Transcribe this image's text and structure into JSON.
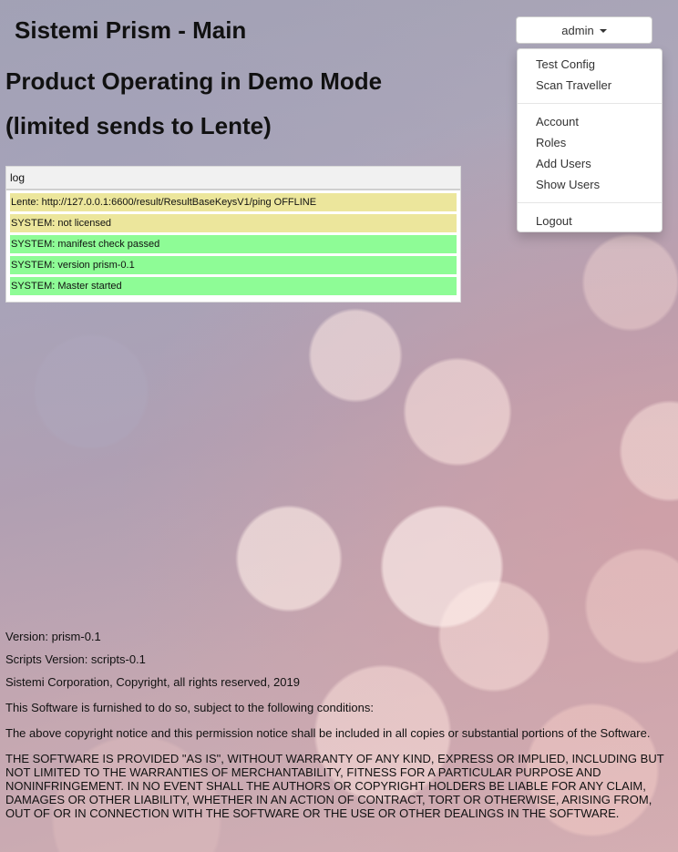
{
  "header": {
    "title": "Sistemi Prism - Main",
    "user_menu_label": "admin"
  },
  "user_menu": {
    "items": [
      {
        "label": "Test Config"
      },
      {
        "label": "Scan Traveller"
      },
      {
        "label": "Account"
      },
      {
        "label": "Roles"
      },
      {
        "label": "Add Users"
      },
      {
        "label": "Show Users"
      },
      {
        "label": "Logout"
      }
    ]
  },
  "demo_notice": {
    "line1": "Product Operating in Demo Mode",
    "line2": "(limited sends to Lente)"
  },
  "log": {
    "header": "log",
    "entries": [
      {
        "text": "Lente: http://127.0.0.1:6600/result/ResultBaseKeysV1/ping OFFLINE",
        "status": "warning",
        "color": "#ece69c"
      },
      {
        "text": "SYSTEM: not licensed",
        "status": "warning",
        "color": "#ece69c"
      },
      {
        "text": "SYSTEM: manifest check passed",
        "status": "ok",
        "color": "#8efc96"
      },
      {
        "text": "SYSTEM: version prism-0.1",
        "status": "ok",
        "color": "#8efc96"
      },
      {
        "text": "SYSTEM: Master started",
        "status": "ok",
        "color": "#8efc96"
      }
    ]
  },
  "footer": {
    "version": "Version: prism-0.1",
    "scripts_version": "Scripts Version: scripts-0.1",
    "copyright": "Sistemi Corporation, Copyright, all rights reserved, 2019",
    "conditions": "This Software is furnished to do so, subject to the following conditions:",
    "notice": "The above copyright notice and this permission notice shall be included in all copies or substantial portions of the Software.",
    "warranty": "THE SOFTWARE IS PROVIDED \"AS IS\", WITHOUT WARRANTY OF ANY KIND, EXPRESS OR IMPLIED, INCLUDING BUT NOT LIMITED TO THE WARRANTIES OF MERCHANTABILITY, FITNESS FOR A PARTICULAR PURPOSE AND NONINFRINGEMENT. IN NO EVENT SHALL THE AUTHORS OR COPYRIGHT HOLDERS BE LIABLE FOR ANY CLAIM, DAMAGES OR OTHER LIABILITY, WHETHER IN AN ACTION OF CONTRACT, TORT OR OTHERWISE, ARISING FROM, OUT OF OR IN CONNECTION WITH THE SOFTWARE OR THE USE OR OTHER DEALINGS IN THE SOFTWARE."
  },
  "icons": {
    "user_menu_caret": "caret-down-icon"
  }
}
